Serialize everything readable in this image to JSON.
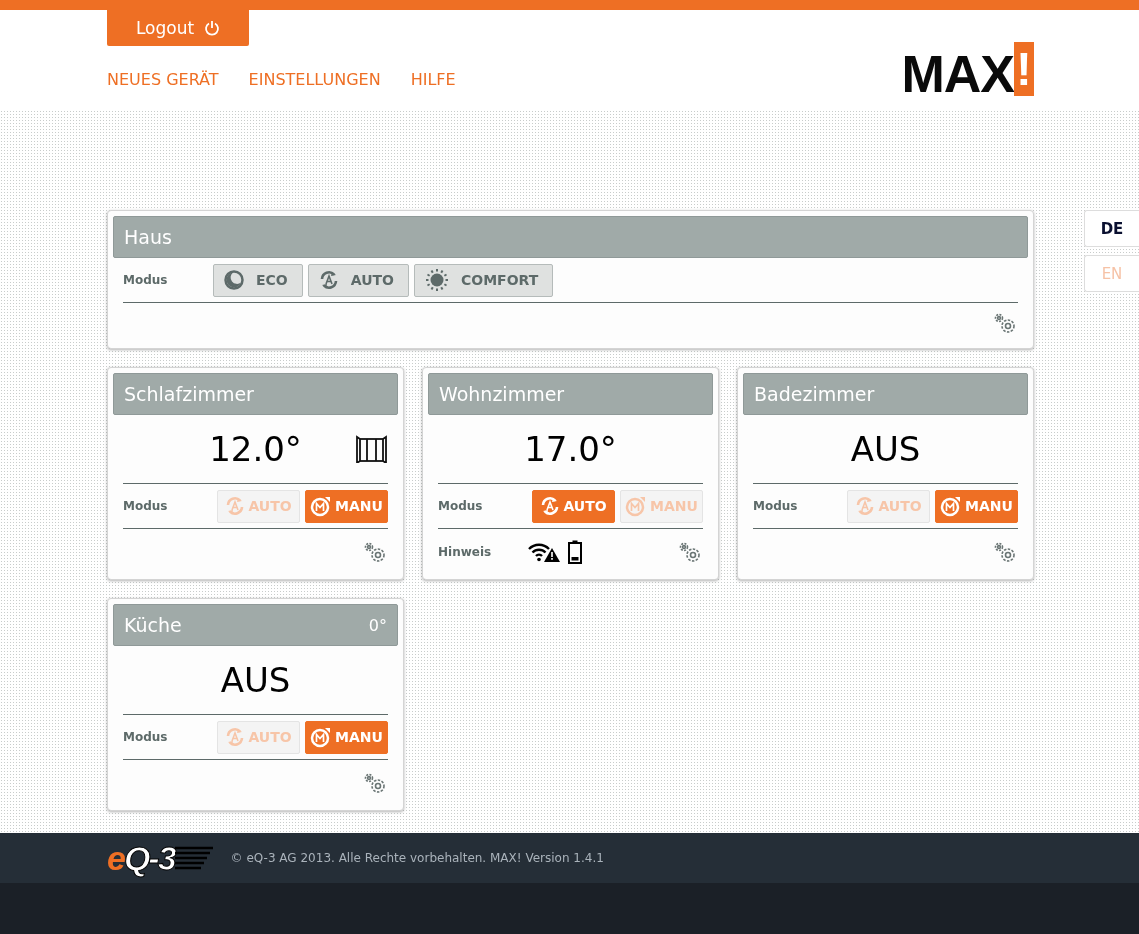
{
  "header": {
    "logout": "Logout",
    "nav": [
      "NEUES GERÄT",
      "EINSTELLUNGEN",
      "HILFE"
    ],
    "logo": {
      "text": "MAX",
      "mark": "!"
    }
  },
  "languages": [
    {
      "label": "DE",
      "selected": true
    },
    {
      "label": "EN",
      "selected": false
    }
  ],
  "house": {
    "title": "Haus",
    "mode_label": "Modus",
    "modes": [
      {
        "kind": "eco",
        "label": "ECO"
      },
      {
        "kind": "auto",
        "label": "AUTO"
      },
      {
        "kind": "comfort",
        "label": "COMFORT"
      }
    ]
  },
  "rooms": [
    {
      "name": "Schlafzimmer",
      "display": "12.0°",
      "window_open": true,
      "mode_label": "Modus",
      "modes": [
        {
          "kind": "auto",
          "label": "AUTO",
          "selected": false
        },
        {
          "kind": "manu",
          "label": "MANU",
          "selected": true
        }
      ]
    },
    {
      "name": "Wohnzimmer",
      "display": "17.0°",
      "window_open": false,
      "mode_label": "Modus",
      "modes": [
        {
          "kind": "auto",
          "label": "AUTO",
          "selected": true
        },
        {
          "kind": "manu",
          "label": "MANU",
          "selected": false
        }
      ],
      "hint": {
        "label": "Hinweis",
        "signals": [
          {
            "kind": "radio-warning"
          },
          {
            "kind": "battery"
          }
        ]
      }
    },
    {
      "name": "Badezimmer",
      "display": "AUS",
      "window_open": false,
      "mode_label": "Modus",
      "modes": [
        {
          "kind": "auto",
          "label": "AUTO",
          "selected": false
        },
        {
          "kind": "manu",
          "label": "MANU",
          "selected": true
        }
      ]
    },
    {
      "name": "Küche",
      "reading": "0°",
      "display": "AUS",
      "window_open": false,
      "mode_label": "Modus",
      "modes": [
        {
          "kind": "auto",
          "label": "AUTO",
          "selected": false
        },
        {
          "kind": "manu",
          "label": "MANU",
          "selected": true
        }
      ]
    }
  ],
  "footer": {
    "logo": {
      "prefix": "e",
      "rest": "Q-3"
    },
    "copyright": "© eQ-3 AG 2013. Alle Rechte vorbehalten. MAX! Version 1.4.1"
  }
}
